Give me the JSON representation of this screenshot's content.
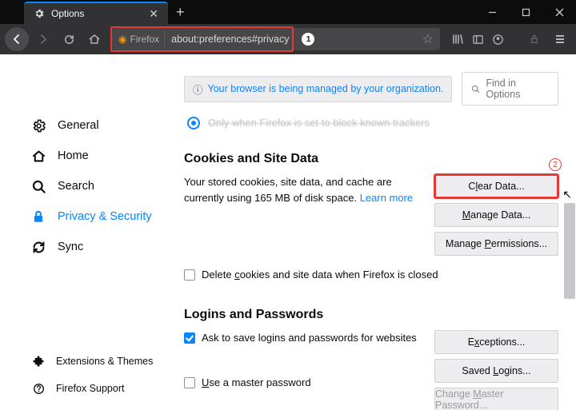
{
  "tab": {
    "title": "Options"
  },
  "url": {
    "identity": "Firefox",
    "value": "about:preferences#privacy",
    "badge": "1"
  },
  "notice": "Your browser is being managed by your organization.",
  "search": {
    "placeholder": "Find in Options"
  },
  "stale_row": "Only when Firefox is set to block known trackers",
  "sidebar": {
    "items": [
      {
        "label": "General"
      },
      {
        "label": "Home"
      },
      {
        "label": "Search"
      },
      {
        "label": "Privacy & Security"
      },
      {
        "label": "Sync"
      }
    ],
    "footer": [
      {
        "label": "Extensions & Themes"
      },
      {
        "label": "Firefox Support"
      }
    ]
  },
  "cookies": {
    "heading": "Cookies and Site Data",
    "desc1": "Your stored cookies, site data, and cache are currently using ",
    "size": "165 MB",
    "desc2": " of disk space.  ",
    "learn": "Learn more",
    "del_label_pre": "Delete ",
    "del_label_u": "c",
    "del_label_post": "ookies and site data when Firefox is closed",
    "clear_pre": "C",
    "clear_u": "l",
    "clear_post": "ear Data...",
    "manage_pre": "",
    "manage_u": "M",
    "manage_post": "anage Data...",
    "perm_pre": "Manage ",
    "perm_u": "P",
    "perm_post": "ermissions...",
    "callout": "2"
  },
  "logins": {
    "heading": "Logins and Passwords",
    "ask": "Ask to save logins and passwords for websites",
    "master_pre": "",
    "master_u": "U",
    "master_post": "se a master password",
    "exc_pre": "E",
    "exc_u": "x",
    "exc_post": "ceptions...",
    "saved_pre": "Saved ",
    "saved_u": "L",
    "saved_post": "ogins...",
    "chg_pre": "Change ",
    "chg_u": "M",
    "chg_post": "aster Password..."
  }
}
